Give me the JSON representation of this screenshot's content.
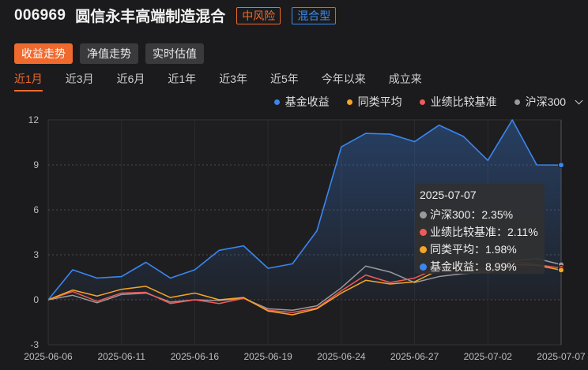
{
  "header": {
    "code": "006969",
    "name": "圆信永丰高端制造混合",
    "risk_tag": "中风险",
    "type_tag": "混合型"
  },
  "view_buttons": [
    "收益走势",
    "净值走势",
    "实时估值"
  ],
  "active_view": 0,
  "periods": [
    "近1月",
    "近3月",
    "近6月",
    "近1年",
    "近3年",
    "近5年",
    "今年以来",
    "成立来"
  ],
  "active_period": 0,
  "legend": [
    {
      "label": "基金收益",
      "color": "#3a86ee"
    },
    {
      "label": "同类平均",
      "color": "#f5a623"
    },
    {
      "label": "业绩比较基准",
      "color": "#f25a5a"
    },
    {
      "label": "沪深300",
      "color": "#9a9a9a"
    }
  ],
  "tooltip": {
    "date": "2025-07-07",
    "rows": [
      {
        "text": "沪深300：2.35%",
        "color": "#9a9a9a"
      },
      {
        "text": "业绩比较基准：2.11%",
        "color": "#f25a5a"
      },
      {
        "text": "同类平均：1.98%",
        "color": "#f5a623"
      },
      {
        "text": "基金收益：8.99%",
        "color": "#3a86ee"
      }
    ]
  },
  "chart_data": {
    "type": "line",
    "yticks": [
      12,
      9,
      6,
      3,
      0,
      -3
    ],
    "ylim": [
      -3,
      12
    ],
    "x_tick_labels": [
      "2025-06-06",
      "2025-06-11",
      "2025-06-16",
      "2025-06-19",
      "2025-06-24",
      "2025-06-27",
      "2025-07-02",
      "2025-07-07"
    ],
    "x_tick_index": [
      0,
      3,
      6,
      9,
      12,
      15,
      18,
      21
    ],
    "grid": true,
    "series": [
      {
        "name": "基金收益",
        "color": "#3a86ee",
        "area": true,
        "values": [
          0,
          2.0,
          1.45,
          1.55,
          2.5,
          1.45,
          2.0,
          3.3,
          3.6,
          2.1,
          2.4,
          4.6,
          10.2,
          11.1,
          11.05,
          10.55,
          11.65,
          10.9,
          9.3,
          12.0,
          9.0,
          8.99
        ]
      },
      {
        "name": "沪深300",
        "color": "#9a9a9a",
        "area": false,
        "values": [
          0,
          0.3,
          -0.2,
          0.35,
          0.45,
          -0.15,
          0.0,
          -0.05,
          0.1,
          -0.6,
          -0.7,
          -0.4,
          0.8,
          2.25,
          1.85,
          1.15,
          1.55,
          1.75,
          1.85,
          2.6,
          2.75,
          2.35
        ]
      },
      {
        "name": "业绩比较基准",
        "color": "#f25a5a",
        "area": false,
        "values": [
          0,
          0.55,
          -0.1,
          0.45,
          0.5,
          -0.25,
          0.0,
          -0.25,
          0.1,
          -0.7,
          -0.85,
          -0.55,
          0.6,
          1.65,
          1.15,
          1.45,
          2.15,
          2.35,
          1.95,
          2.55,
          2.35,
          2.11
        ]
      },
      {
        "name": "同类平均",
        "color": "#f5a623",
        "area": false,
        "values": [
          0,
          0.65,
          0.25,
          0.7,
          0.9,
          0.15,
          0.45,
          0.0,
          0.15,
          -0.75,
          -1.0,
          -0.6,
          0.45,
          1.3,
          1.05,
          1.2,
          2.0,
          2.2,
          1.8,
          2.35,
          2.3,
          1.98
        ]
      }
    ]
  }
}
